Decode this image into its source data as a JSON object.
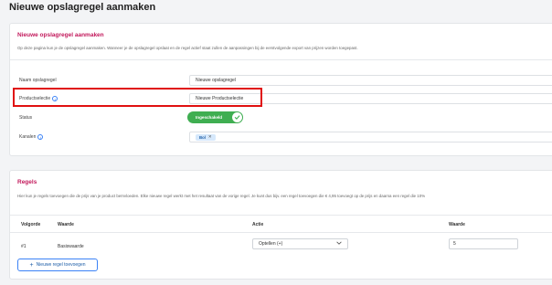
{
  "page": {
    "title": "Nieuwe opslagregel aanmaken"
  },
  "rule_card": {
    "title": "Nieuwe opslagregel aanmaken",
    "description": "Op deze pagina kun je de opslagregel aanmaken. Wanneer je de opslagregel opslaat en de regel actief staat zullen de aanpassingen bij de eerstvolgende export van prijzen worden toegepast.",
    "fields": {
      "name_label": "Naam opslagregel",
      "name_value": "Nieuwe opslagregel",
      "selection_label": "Productselectie",
      "selection_value": "Nieuwe Productselectie",
      "status_label": "Status",
      "status_value": "Ingeschakeld",
      "channels_label": "Kanalen",
      "channel_tag": "Bol"
    },
    "info_icon": "info-icon",
    "highlight_color": "#e01010"
  },
  "rules_card": {
    "title": "Regels",
    "description": "Hier kun je regels toevoegen die de prijs van je product beïnvloeden. Elke nieuwe regel werkt met het resultaat van de vorige regel. Je kunt dus bijv. een regel toevoegen die € 4,95 toevoegt op de prijs en daarna een regel die 10%",
    "columns": [
      "Volgorde",
      "Waarde",
      "Actie",
      "Waarde"
    ],
    "rows": [
      {
        "order": "#1",
        "value": "Basiswaarde",
        "action": "Optellen (+)",
        "amount": "5"
      }
    ],
    "add_button": "Nieuwe regel toevoegen"
  },
  "colors": {
    "accent": "#c2185b",
    "toggle_on": "#3fae51",
    "link_blue": "#1f5fa8"
  }
}
